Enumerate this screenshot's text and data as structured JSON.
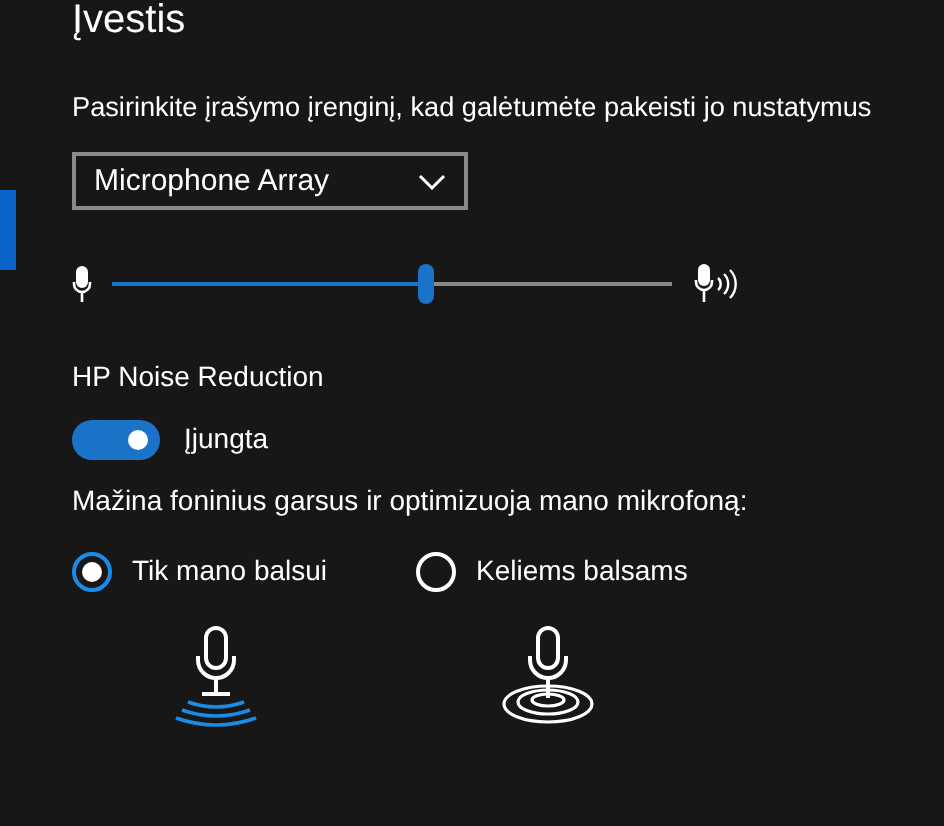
{
  "heading": "Įvestis",
  "device_prompt": "Pasirinkite įrašymo įrenginį, kad galėtumėte pakeisti jo nustatymus",
  "device_dropdown": {
    "value": "Microphone Array"
  },
  "volume": {
    "level": 0.56
  },
  "noise_reduction": {
    "title": "HP Noise Reduction",
    "on": true,
    "state_label": "Įjungta"
  },
  "mode_prompt": "Mažina foninius garsus ir optimizuoja mano mikrofoną:",
  "modes": [
    {
      "label": "Tik mano balsui",
      "selected": true,
      "kind": "waves"
    },
    {
      "label": "Keliems balsams",
      "selected": false,
      "kind": "rings"
    }
  ]
}
